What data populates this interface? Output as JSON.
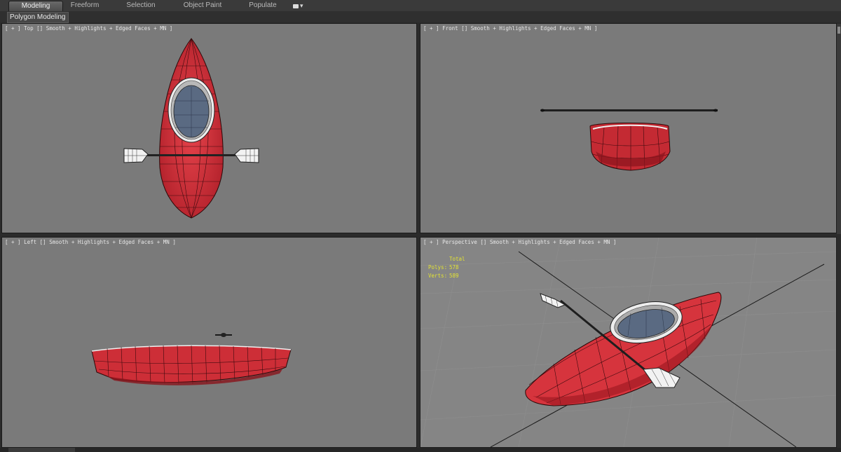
{
  "ribbon": {
    "tabs": [
      {
        "label": "Modeling",
        "active": true
      },
      {
        "label": "Freeform",
        "active": false
      },
      {
        "label": "Selection",
        "active": false
      },
      {
        "label": "Object Paint",
        "active": false
      },
      {
        "label": "Populate",
        "active": false
      }
    ],
    "options_icon": "camera-icon",
    "options_arrow": "▾"
  },
  "subbar": {
    "label": "Polygon Modeling"
  },
  "viewports": {
    "top": {
      "label": "[ + ] Top [] Smooth + Highlights + Edged Faces + MN ]"
    },
    "front": {
      "label": "[ + ] Front [] Smooth + Highlights + Edged Faces + MN ]"
    },
    "left": {
      "label": "[ + ] Left [] Smooth + Highlights + Edged Faces + MN ]"
    },
    "perspective": {
      "label": "[ + ] Perspective [] Smooth + Highlights + Edged Faces + MN ]",
      "stats": {
        "header": "Total",
        "polys_label": "Polys:",
        "polys": "578",
        "verts_label": "Verts:",
        "verts": "589"
      }
    }
  },
  "colors": {
    "viewport_bg": "#7a7a7a",
    "kayak_red": "#d9343d",
    "cockpit_blue": "#5a6a82",
    "stats_yellow": "#e2e234"
  }
}
